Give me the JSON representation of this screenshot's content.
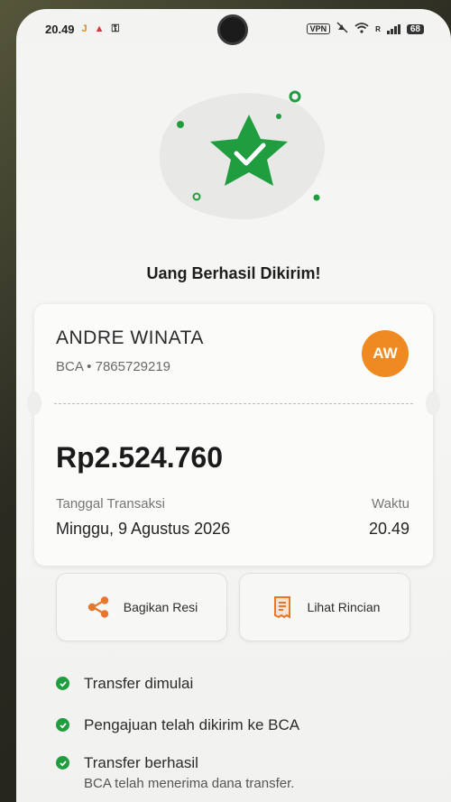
{
  "status_bar": {
    "time": "20.49",
    "notif_glyphs": [
      "J",
      "▲",
      "⚿"
    ],
    "vpn": "VPN",
    "signal_type": "R",
    "battery": "68"
  },
  "illustration": {
    "icon": "star-check-icon"
  },
  "headline": "Uang Berhasil Dikirim!",
  "receipt": {
    "recipient_name": "ANDRE WINATA",
    "recipient_account": "BCA • 7865729219",
    "avatar_initials": "AW",
    "amount": "Rp2.524.760",
    "date_label": "Tanggal Transaksi",
    "date_value": "Minggu, 9 Agustus 2026",
    "time_label": "Waktu",
    "time_value": "20.49"
  },
  "actions": {
    "share_label": "Bagikan Resi",
    "detail_label": "Lihat Rincian"
  },
  "timeline": {
    "step1": "Transfer dimulai",
    "step2": "Pengajuan telah dikirim ke BCA",
    "step3": "Transfer berhasil",
    "step3_sub": "BCA telah menerima dana transfer."
  },
  "colors": {
    "success_green": "#1f9d3f",
    "avatar_orange": "#ef8a22",
    "icon_orange": "#e8772e"
  }
}
